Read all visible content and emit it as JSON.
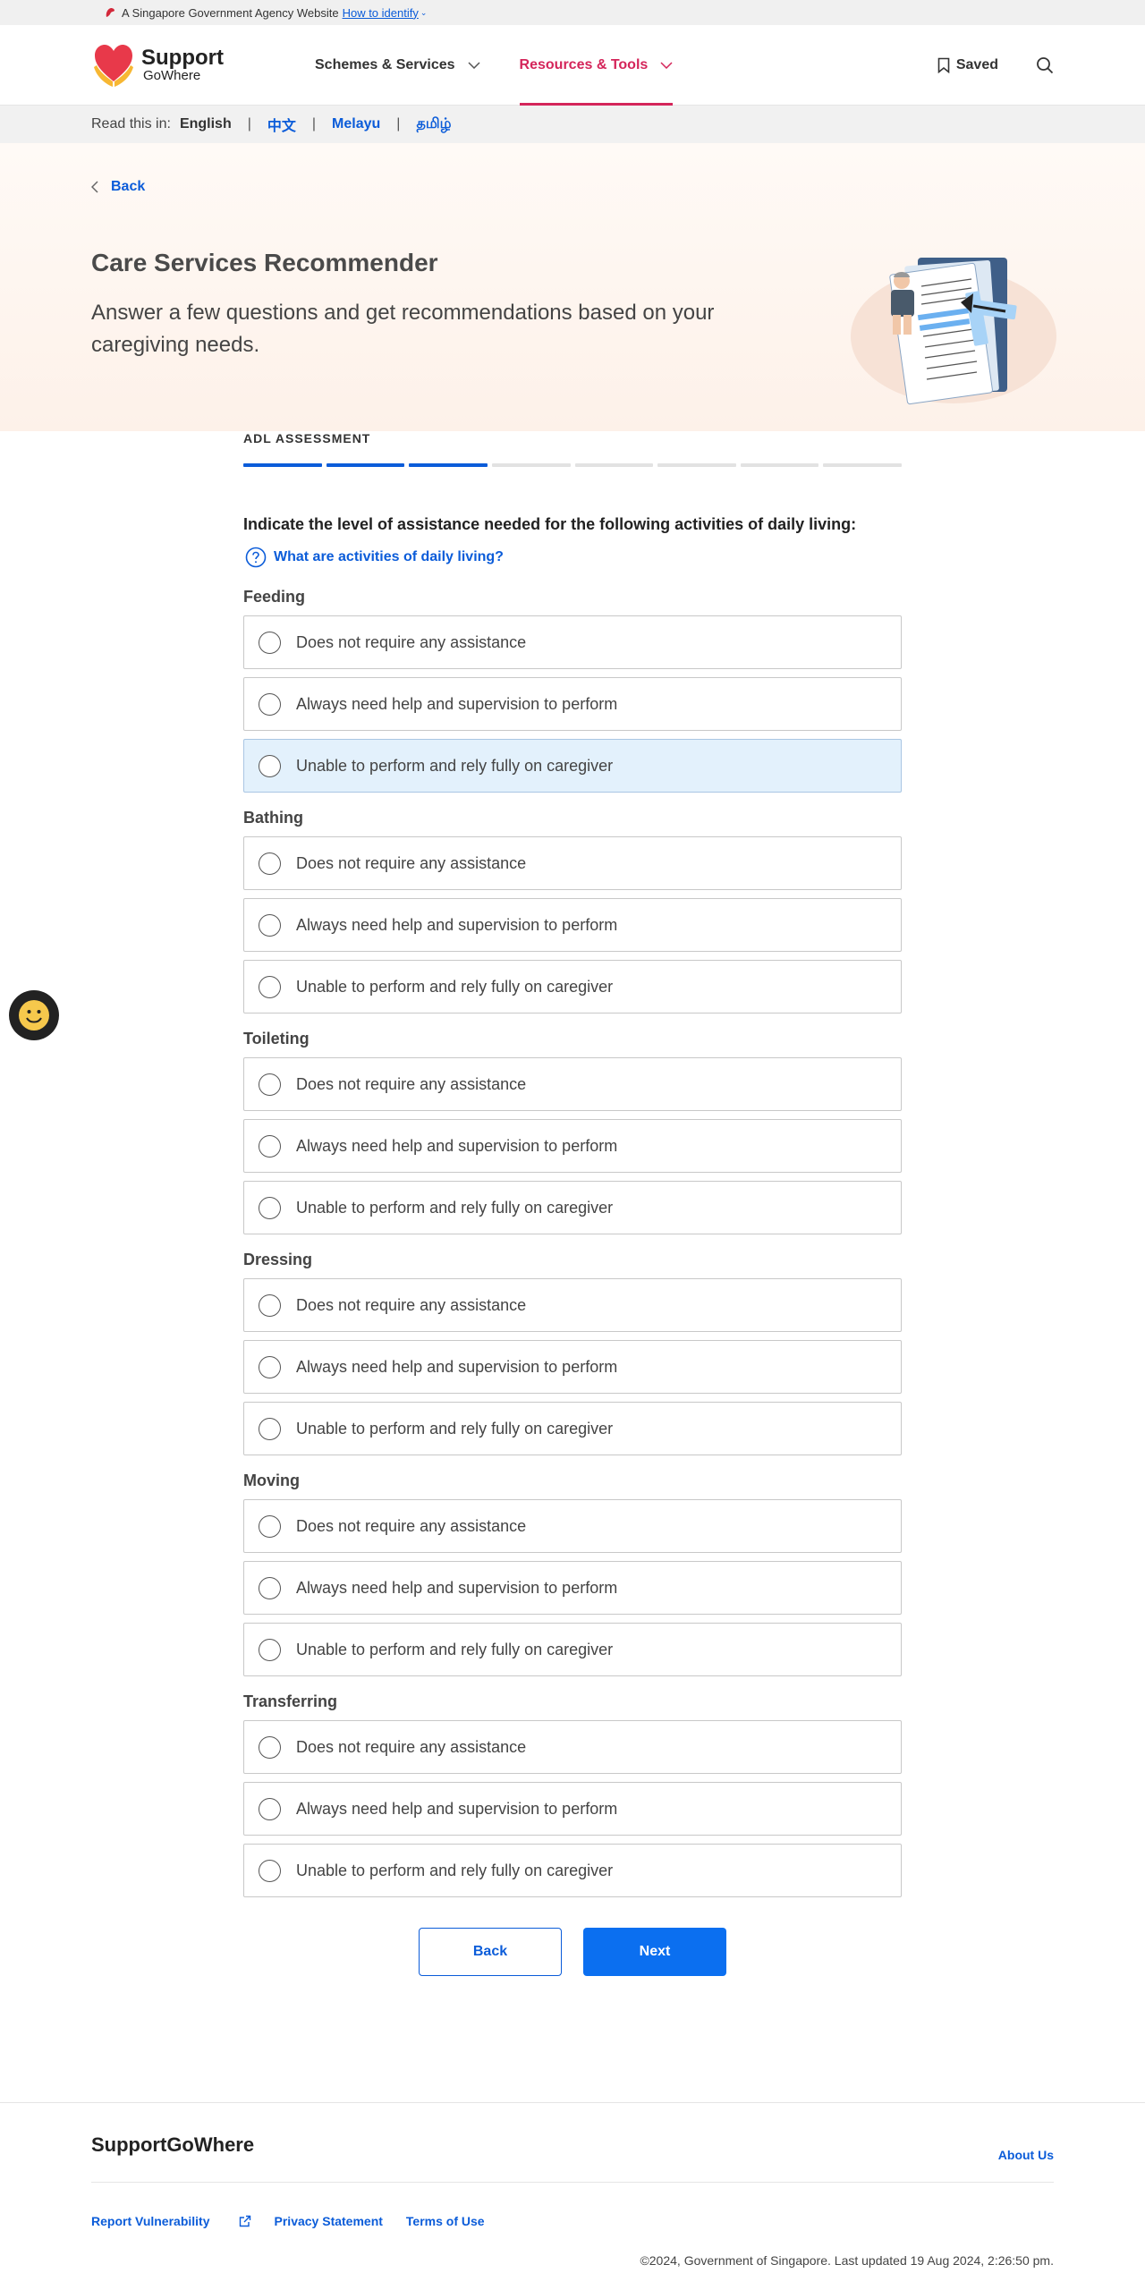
{
  "masthead": {
    "text": "A Singapore Government Agency Website",
    "link": "How to identify"
  },
  "header": {
    "logo_line1": "Support",
    "logo_line2": "GoWhere",
    "nav": [
      {
        "label": "Schemes & Services"
      },
      {
        "label": "Resources & Tools"
      }
    ],
    "saved_label": "Saved"
  },
  "langbar": {
    "label": "Read this in:",
    "languages": [
      "English",
      "中文",
      "Melayu",
      "தமிழ்"
    ]
  },
  "hero": {
    "back_label": "Back",
    "title": "Care Services Recommender",
    "subtitle": "Answer a few questions and get recommendations based on your caregiving needs."
  },
  "form": {
    "step_label": "ADL ASSESSMENT",
    "progress_completed": 3,
    "progress_total": 8,
    "question": "Indicate the level of assistance needed for the following activities of daily living:",
    "help_link": "What are activities of daily living?",
    "groups": [
      {
        "title": "Feeding",
        "options": [
          "Does not require any assistance",
          "Always need help and supervision to perform",
          "Unable to perform and rely fully on caregiver"
        ]
      },
      {
        "title": "Bathing",
        "options": [
          "Does not require any assistance",
          "Always need help and supervision to perform",
          "Unable to perform and rely fully on caregiver"
        ]
      },
      {
        "title": "Toileting",
        "options": [
          "Does not require any assistance",
          "Always need help and supervision to perform",
          "Unable to perform and rely fully on caregiver"
        ]
      },
      {
        "title": "Dressing",
        "options": [
          "Does not require any assistance",
          "Always need help and supervision to perform",
          "Unable to perform and rely fully on caregiver"
        ]
      },
      {
        "title": "Moving",
        "options": [
          "Does not require any assistance",
          "Always need help and supervision to perform",
          "Unable to perform and rely fully on caregiver"
        ]
      },
      {
        "title": "Transferring",
        "options": [
          "Does not require any assistance",
          "Always need help and supervision to perform",
          "Unable to perform and rely fully on caregiver"
        ]
      }
    ],
    "back_button": "Back",
    "next_button": "Next"
  },
  "footer": {
    "brand": "SupportGoWhere",
    "about": "About Us",
    "links": [
      "Report Vulnerability",
      "Privacy Statement",
      "Terms of Use"
    ],
    "copyright": "©2024, Government of Singapore. Last updated 19 Aug 2024, 2:26:50 pm."
  },
  "colors": {
    "accent_blue": "#0b5cd9",
    "nav_active": "#d4255a",
    "highlight_option": "#e3f1fc"
  }
}
